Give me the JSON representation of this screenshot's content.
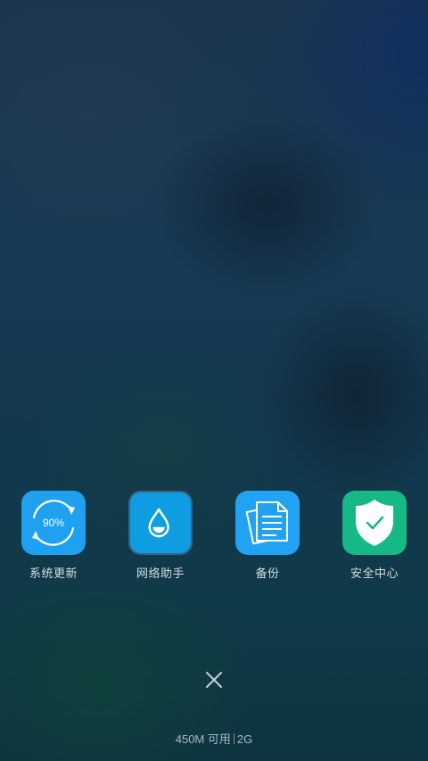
{
  "apps": [
    {
      "label": "系统更新",
      "icon": "sync-progress-icon",
      "progress_text": "90%",
      "color": "#1fa1f1"
    },
    {
      "label": "网络助手",
      "icon": "water-drop-icon",
      "color": "#0d9de0"
    },
    {
      "label": "备份",
      "icon": "documents-icon",
      "color": "#22a2f2"
    },
    {
      "label": "安全中心",
      "icon": "shield-check-icon",
      "color": "#16b886"
    }
  ],
  "close": {
    "icon": "close-icon"
  },
  "memory": {
    "available": "450M",
    "available_label": "可用",
    "total": "2G"
  }
}
